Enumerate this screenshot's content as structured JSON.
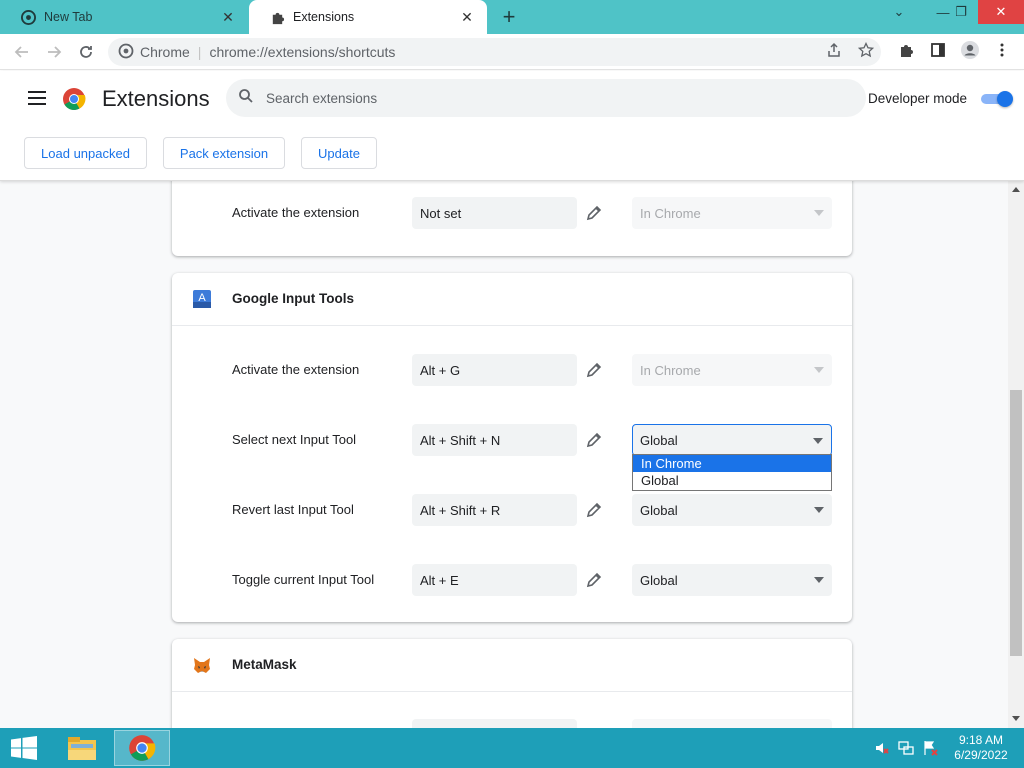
{
  "browser": {
    "tabs": [
      {
        "title": "New Tab",
        "icon": "chrome-icon",
        "active": false
      },
      {
        "title": "Extensions",
        "icon": "puzzle-icon",
        "active": true
      }
    ],
    "omnibox": {
      "site": "Chrome",
      "url": "chrome://extensions/shortcuts"
    }
  },
  "extensions_page": {
    "title": "Extensions",
    "search_placeholder": "Search extensions",
    "developer_mode_label": "Developer mode",
    "developer_mode_on": true,
    "buttons": {
      "load_unpacked": "Load unpacked",
      "pack_extension": "Pack extension",
      "update": "Update"
    }
  },
  "cards": [
    {
      "name": "",
      "rows": [
        {
          "label": "Activate the extension",
          "shortcut": "Not set",
          "scope": "In Chrome",
          "scope_disabled": true
        }
      ]
    },
    {
      "name": "Google Input Tools",
      "icon": "google-input-tools-icon",
      "rows": [
        {
          "label": "Activate the extension",
          "shortcut": "Alt + G",
          "scope": "In Chrome",
          "scope_disabled": true
        },
        {
          "label": "Select next Input Tool",
          "shortcut": "Alt + Shift + N",
          "scope": "Global",
          "scope_disabled": false
        },
        {
          "label": "Revert last Input Tool",
          "shortcut": "Alt + Shift + R",
          "scope": "Global",
          "scope_disabled": false
        },
        {
          "label": "Toggle current Input Tool",
          "shortcut": "Alt + E",
          "scope": "Global",
          "scope_disabled": false
        }
      ]
    },
    {
      "name": "MetaMask",
      "icon": "metamask-fox-icon",
      "rows": []
    }
  ],
  "open_dropdown": {
    "options": [
      "In Chrome",
      "Global"
    ],
    "highlighted": "In Chrome"
  },
  "taskbar": {
    "time": "9:18 AM",
    "date": "6/29/2022"
  },
  "colors": {
    "tab_strip": "#4fc3c7",
    "accent": "#1a73e8",
    "taskbar": "#1e9fb8"
  }
}
